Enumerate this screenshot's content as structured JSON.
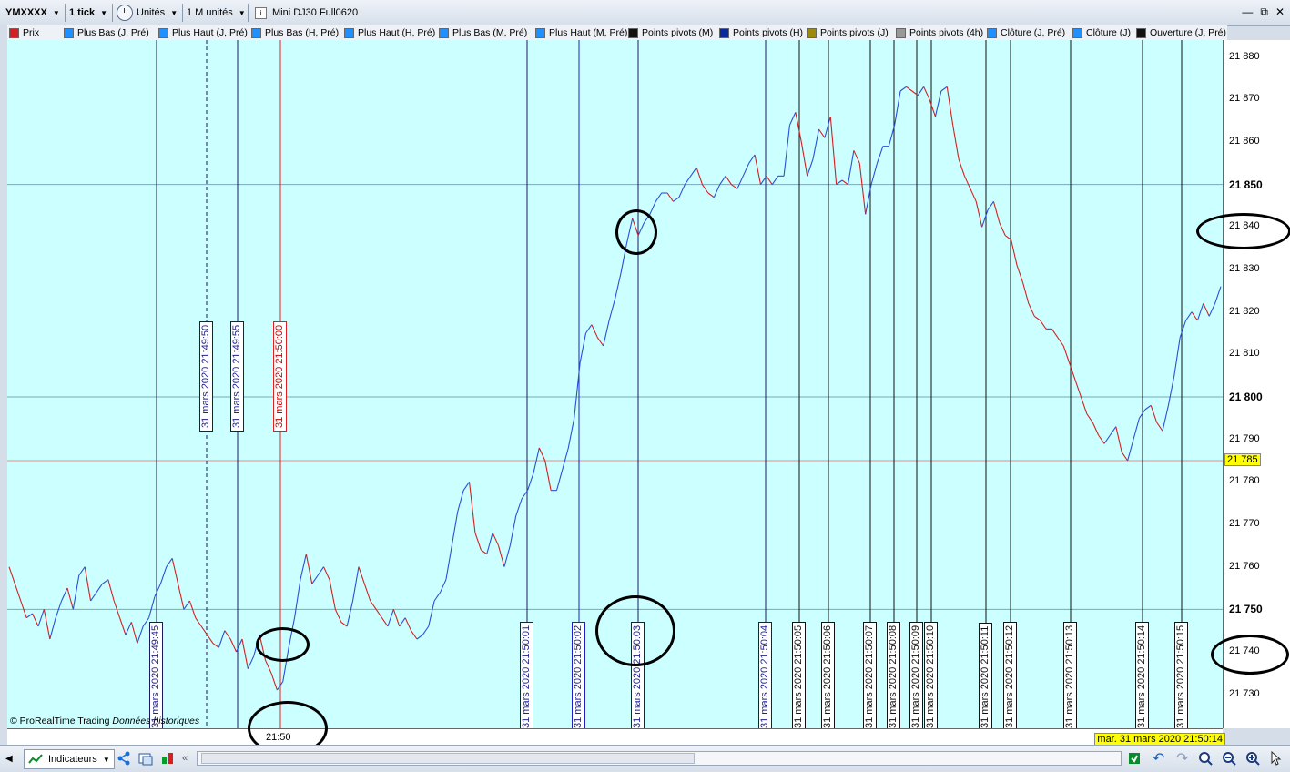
{
  "toolbar": {
    "instrument": "YMXXXX",
    "timeframe": "1 tick",
    "units_mode": "Unités",
    "units_count": "1 M unités",
    "product_name": "Mini DJ30 Full0620",
    "window_controls": [
      "—",
      "⧉",
      "✕"
    ]
  },
  "legend": [
    {
      "label": "Prix",
      "color": "#d42020"
    },
    {
      "label": "Plus Bas (J, Pré)",
      "color": "#1e90ff"
    },
    {
      "label": "Plus Haut (J, Pré)",
      "color": "#1e90ff"
    },
    {
      "label": "Plus Bas (H, Pré)",
      "color": "#1e90ff"
    },
    {
      "label": "Plus Haut (H, Pré)",
      "color": "#1e90ff"
    },
    {
      "label": "Plus Bas (M, Pré)",
      "color": "#1e90ff"
    },
    {
      "label": "Plus Haut (M, Pré)",
      "color": "#1e90ff"
    },
    {
      "label": "Points pivots (M)",
      "color": "#111111"
    },
    {
      "label": "Points pivots (H)",
      "color": "#0a2a9c"
    },
    {
      "label": "Points pivots (J)",
      "color": "#9c8a10"
    },
    {
      "label": "Points pivots (4h)",
      "color": "#999999"
    },
    {
      "label": "Clôture (J, Pré)",
      "color": "#1e90ff"
    },
    {
      "label": "Clôture (J)",
      "color": "#1e90ff"
    },
    {
      "label": "Ouverture (J, Pré)",
      "color": "#111111"
    }
  ],
  "chart_data": {
    "type": "line",
    "ylim": [
      21722,
      21884
    ],
    "y_ticks": [
      21730,
      21740,
      21750,
      21760,
      21770,
      21780,
      21790,
      21800,
      21810,
      21820,
      21830,
      21840,
      21850,
      21860,
      21870,
      21880
    ],
    "y_bold_ticks": [
      21750,
      21800,
      21850
    ],
    "current_price": "21 785",
    "x_axis_label": "21:50",
    "last_date": "mar. 31 mars 2020 21:50:14",
    "series": [
      {
        "values": [
          21760,
          21756,
          21752,
          21748,
          21749,
          21746,
          21750,
          21743,
          21748,
          21752,
          21755,
          21750,
          21758,
          21760,
          21752,
          21754,
          21756,
          21757,
          21752,
          21748,
          21744,
          21747,
          21742,
          21746,
          21748,
          21753,
          21756,
          21760,
          21762,
          21756,
          21750,
          21752,
          21748,
          21746,
          21744,
          21742,
          21741,
          21745,
          21743,
          21740,
          21743,
          21736,
          21739,
          21744,
          21738,
          21735,
          21731,
          21733,
          21741,
          21748,
          21757,
          21763,
          21756,
          21758,
          21760,
          21757,
          21750,
          21747,
          21746,
          21752,
          21760,
          21756,
          21752,
          21750,
          21748,
          21746,
          21750,
          21746,
          21748,
          21745,
          21743,
          21744,
          21746,
          21752,
          21754,
          21757,
          21765,
          21773,
          21778,
          21780,
          21768,
          21764,
          21763,
          21768,
          21765,
          21760,
          21765,
          21772,
          21776,
          21778,
          21782,
          21788,
          21785,
          21778,
          21778,
          21783,
          21788,
          21795,
          21808,
          21815,
          21817,
          21814,
          21812,
          21818,
          21823,
          21829,
          21836,
          21842,
          21838,
          21841,
          21843,
          21846,
          21848,
          21848,
          21846,
          21847,
          21850,
          21852,
          21854,
          21850,
          21848,
          21847,
          21850,
          21852,
          21850,
          21849,
          21852,
          21855,
          21857,
          21850,
          21852,
          21850,
          21852,
          21852,
          21864,
          21867,
          21860,
          21852,
          21856,
          21863,
          21861,
          21866,
          21850,
          21851,
          21850,
          21858,
          21855,
          21843,
          21850,
          21855,
          21859,
          21859,
          21864,
          21872,
          21873,
          21872,
          21871,
          21873,
          21870,
          21866,
          21872,
          21873,
          21864,
          21856,
          21852,
          21849,
          21846,
          21840,
          21844,
          21846,
          21841,
          21838,
          21837,
          21831,
          21827,
          21822,
          21819,
          21818,
          21816,
          21816,
          21814,
          21812,
          21808,
          21804,
          21800,
          21796,
          21794,
          21791,
          21789,
          21791,
          21793,
          21787,
          21785,
          21790,
          21795,
          21797,
          21798,
          21794,
          21792,
          21798,
          21805,
          21814,
          21818,
          21820,
          21818,
          21822,
          21819,
          21822,
          21826
        ]
      }
    ],
    "vertical_markers": [
      {
        "time": "31 mars 2020 21:49:45",
        "label_pos": "bottom",
        "line_color": "#1a1a60",
        "text_color": "#222288"
      },
      {
        "time": "31 mars 2020 21:49:50",
        "label_pos": "top",
        "line_color": "#1a1a60",
        "line_style": "dashed",
        "text_color": "#222288"
      },
      {
        "time": "31 mars 2020 21:49:55",
        "label_pos": "top",
        "line_color": "#1a1a60",
        "text_color": "#222288"
      },
      {
        "time": "31 mars 2020 21:50:00",
        "label_pos": "top",
        "line_color": "#e02020",
        "text_color": "#cc0000"
      },
      {
        "time": "31 mars 2020 21:50:01",
        "label_pos": "bottom",
        "line_color": "#1a1a60",
        "text_color": "#222288"
      },
      {
        "time": "31 mars 2020 21:50:02",
        "label_pos": "bottom",
        "line_color": "#2020c0",
        "text_color": "#222288"
      },
      {
        "time": "31 mars 2020 21:50:03",
        "label_pos": "bottom",
        "line_color": "#1a1a60",
        "text_color": "#222288"
      },
      {
        "time": "31 mars 2020 21:50:04",
        "label_pos": "bottom",
        "line_color": "#1a1a60",
        "text_color": "#222288"
      },
      {
        "time": "31 mars 2020 21:50:05",
        "label_pos": "bottom",
        "line_color": "#111111",
        "text_color": "#111111"
      },
      {
        "time": "31 mars 2020 21:50:06",
        "label_pos": "bottom",
        "line_color": "#111111",
        "text_color": "#111111"
      },
      {
        "time": "31 mars 2020 21:50:07",
        "label_pos": "bottom",
        "line_color": "#111111",
        "text_color": "#111111"
      },
      {
        "time": "31 mars 2020 21:50:08",
        "label_pos": "bottom",
        "line_color": "#111111",
        "text_color": "#111111"
      },
      {
        "time": "31 mars 2020 21:50:09",
        "label_pos": "bottom",
        "line_color": "#111111",
        "text_color": "#111111"
      },
      {
        "time": "31 mars 2020 21:50:10",
        "label_pos": "bottom",
        "line_color": "#111111",
        "text_color": "#111111"
      },
      {
        "time": "31 mars 2020 21:50:11",
        "label_pos": "bottom",
        "line_color": "#111111",
        "text_color": "#111111"
      },
      {
        "time": "31 mars 2020 21:50:12",
        "label_pos": "bottom",
        "line_color": "#111111",
        "text_color": "#111111"
      },
      {
        "time": "31 mars 2020 21:50:13",
        "label_pos": "bottom",
        "line_color": "#111111",
        "text_color": "#111111"
      },
      {
        "time": "31 mars 2020 21:50:14",
        "label_pos": "bottom",
        "line_color": "#111111",
        "text_color": "#111111"
      },
      {
        "time": "31 mars 2020 21:50:15",
        "label_pos": "bottom",
        "line_color": "#111111",
        "text_color": "#111111"
      }
    ]
  },
  "footer": {
    "copyright": "© ProRealTime Trading",
    "data_mode": "Données historiques",
    "indicators_button": "Indicateurs"
  }
}
